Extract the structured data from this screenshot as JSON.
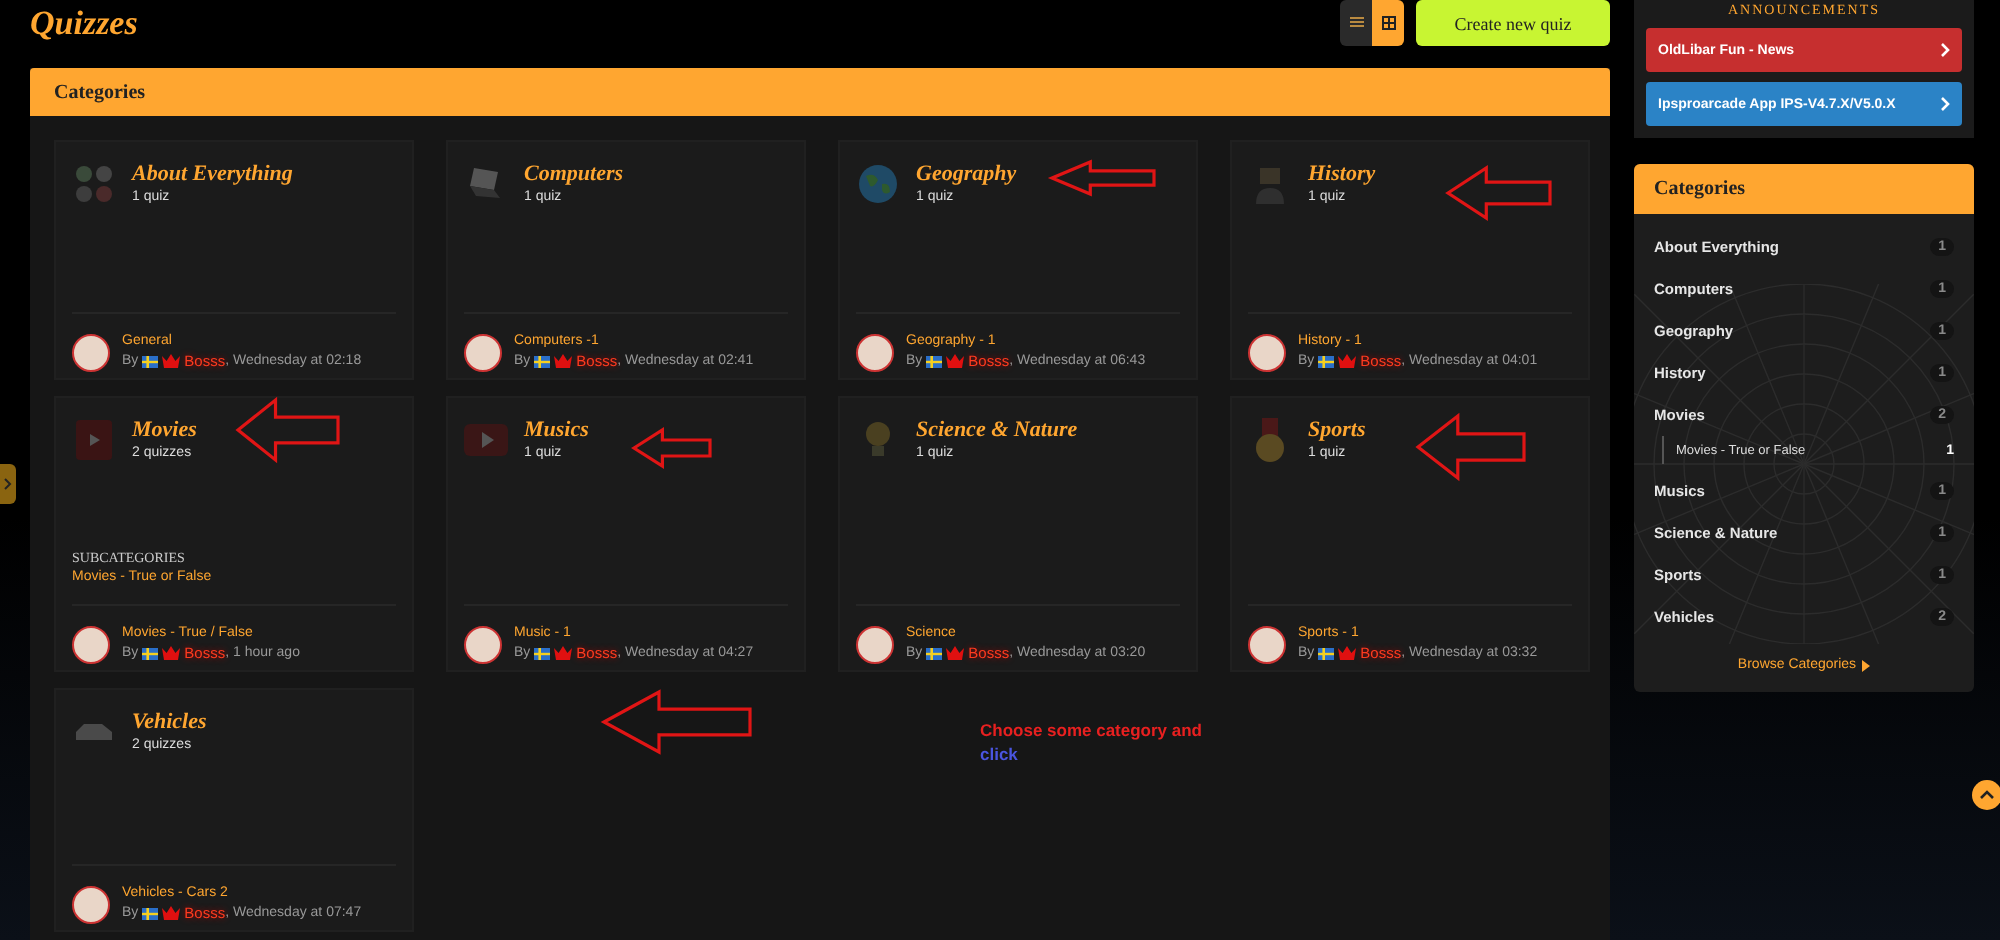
{
  "page_title": "Quizzes",
  "views": [
    {
      "selected": false
    },
    {
      "selected": true
    }
  ],
  "create_button": "Create new quiz",
  "categories_panel": {
    "title": "Categories",
    "cards": [
      {
        "title": "About Everything",
        "count": "1 quiz",
        "latest": "General",
        "by": "By",
        "author": "Bosss",
        "date": ", Wednesday at 02:18"
      },
      {
        "title": "Computers",
        "count": "1 quiz",
        "latest": "Computers -1",
        "by": "By",
        "author": "Bosss",
        "date": ", Wednesday at 02:41"
      },
      {
        "title": "Geography",
        "count": "1 quiz",
        "latest": "Geography - 1",
        "by": "By",
        "author": "Bosss",
        "date": ", Wednesday at 06:43"
      },
      {
        "title": "History",
        "count": "1 quiz",
        "latest": "History - 1",
        "by": "By",
        "author": "Bosss",
        "date": ", Wednesday at 04:01"
      },
      {
        "title": "Movies",
        "count": "2 quizzes",
        "subcategories_label": "SUBCATEGORIES",
        "subcategories": [
          "Movies - True or False"
        ],
        "latest": "Movies - True / False",
        "by": "By",
        "author": "Bosss",
        "date": ", 1 hour ago"
      },
      {
        "title": "Musics",
        "count": "1 quiz",
        "latest": "Music - 1",
        "by": "By",
        "author": "Bosss",
        "date": ", Wednesday at 04:27"
      },
      {
        "title": "Science & Nature",
        "count": "1 quiz",
        "latest": "Science",
        "by": "By",
        "author": "Bosss",
        "date": ", Wednesday at 03:20"
      },
      {
        "title": "Sports",
        "count": "1 quiz",
        "latest": "Sports - 1",
        "by": "By",
        "author": "Bosss",
        "date": ", Wednesday at 03:32"
      },
      {
        "title": "Vehicles",
        "count": "2 quizzes",
        "latest": "Vehicles - Cars 2",
        "by": "By",
        "author": "Bosss",
        "date": ", Wednesday at 07:47"
      }
    ]
  },
  "annotation": {
    "text": "Choose some category and",
    "link": "click"
  },
  "sidebar": {
    "announcements": {
      "title": "ANNOUNCEMENTS",
      "items": [
        {
          "label": "OldLibar Fun - News",
          "color": "#c62f2f"
        },
        {
          "label": "Ipsproarcade App IPS-V4.7.X/V5.0.X",
          "color": "#2b83c6"
        }
      ]
    },
    "categories": {
      "title": "Categories",
      "items": [
        {
          "label": "About Everything",
          "count": "1"
        },
        {
          "label": "Computers",
          "count": "1"
        },
        {
          "label": "Geography",
          "count": "1"
        },
        {
          "label": "History",
          "count": "1"
        },
        {
          "label": "Movies",
          "count": "2",
          "children": [
            {
              "label": "Movies - True or False",
              "count": "1"
            }
          ]
        },
        {
          "label": "Musics",
          "count": "1"
        },
        {
          "label": "Science & Nature",
          "count": "1"
        },
        {
          "label": "Sports",
          "count": "1"
        },
        {
          "label": "Vehicles",
          "count": "2"
        }
      ],
      "browse": "Browse Categories"
    }
  }
}
